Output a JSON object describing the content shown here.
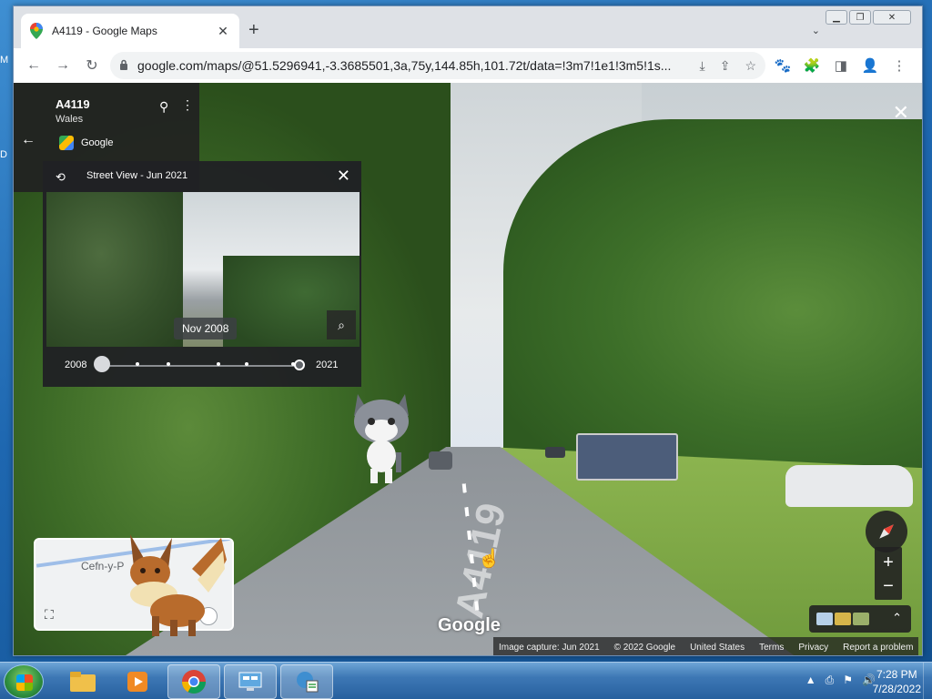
{
  "desktop": {
    "side_labels": [
      "M",
      "D"
    ]
  },
  "browser": {
    "tab_title": "A4119 - Google Maps",
    "tab_close": "✕",
    "new_tab": "+",
    "tab_list": "⌄",
    "window_buttons": {
      "minimize": "▁",
      "restore": "❐",
      "close": "✕"
    },
    "url": "google.com/maps/@51.5296941,-3.3685501,3a,75y,144.85h,101.72t/data=!3m7!1e1!3m5!1s...",
    "nav": {
      "back": "←",
      "forward": "→",
      "reload": "↻"
    },
    "omnibox_icons": [
      "⤓",
      "⇪",
      "☆"
    ],
    "extensions": [
      "🐾",
      "🧩",
      "◨",
      "👤",
      "⋮"
    ]
  },
  "streetview": {
    "close": "✕",
    "info": {
      "title": "A4119",
      "subtitle": "Wales",
      "source": "Google",
      "back": "←",
      "pin": "⚲",
      "more": "⋮"
    },
    "timeline": {
      "history_icon": "⟲",
      "title": "Street View - Jun 2021",
      "close": "✕",
      "photo_date": "Nov 2008",
      "zoom_icon": "⌕",
      "start_year": "2008",
      "end_year": "2021"
    },
    "minimap": {
      "place_label": "Cefn-y-P",
      "expand": "⛶"
    },
    "road_marking": "A4119",
    "controls": {
      "zoom_in": "+",
      "zoom_out": "−",
      "layers_toggle": "⌃"
    },
    "watermark": "Google",
    "footer": [
      "Image capture: Jun 2021",
      "© 2022 Google",
      "United States",
      "Terms",
      "Privacy",
      "Report a problem"
    ]
  },
  "taskbar": {
    "tray_icons": [
      "▲",
      "⎙",
      "⚑",
      "🔊"
    ],
    "time": "7:28 PM",
    "date": "7/28/2022"
  },
  "colors": {
    "chrome_tab_strip": "#dee1e6",
    "omnibox": "#f1f3f4",
    "panel_dark": "#202124",
    "taskbar": "#3d78b5"
  }
}
